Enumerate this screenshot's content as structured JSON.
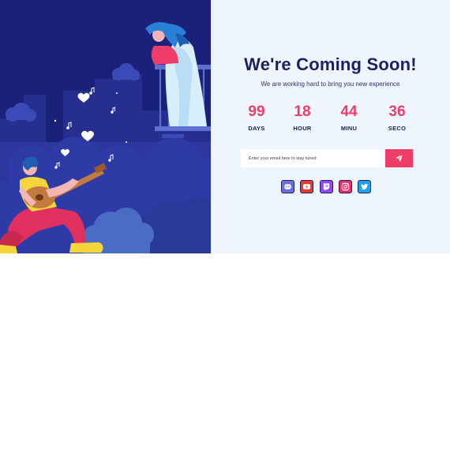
{
  "hero": {
    "title": "We're Coming Soon!",
    "subtitle": "We are working hard to bring you new experience"
  },
  "countdown": [
    {
      "value": "99",
      "label": "DAYS"
    },
    {
      "value": "18",
      "label": "HOUR"
    },
    {
      "value": "44",
      "label": "MINU"
    },
    {
      "value": "36",
      "label": "SECO"
    }
  ],
  "subscribe": {
    "placeholder": "Enter your email here to stay tuned",
    "button_icon": "paper-plane-icon"
  },
  "social": [
    {
      "icon": "discord-icon",
      "color": "#6d6fe0"
    },
    {
      "icon": "youtube-icon",
      "color": "#e8392f"
    },
    {
      "icon": "twitch-icon",
      "color": "#9147ff"
    },
    {
      "icon": "instagram-icon",
      "color": "#e1306c"
    },
    {
      "icon": "twitter-icon",
      "color": "#1da1f2"
    }
  ],
  "colors": {
    "accent": "#ee3d69",
    "heading": "#1c2260",
    "panel_bg": "#eff5fd",
    "illustration_bg": "#1a2178"
  }
}
